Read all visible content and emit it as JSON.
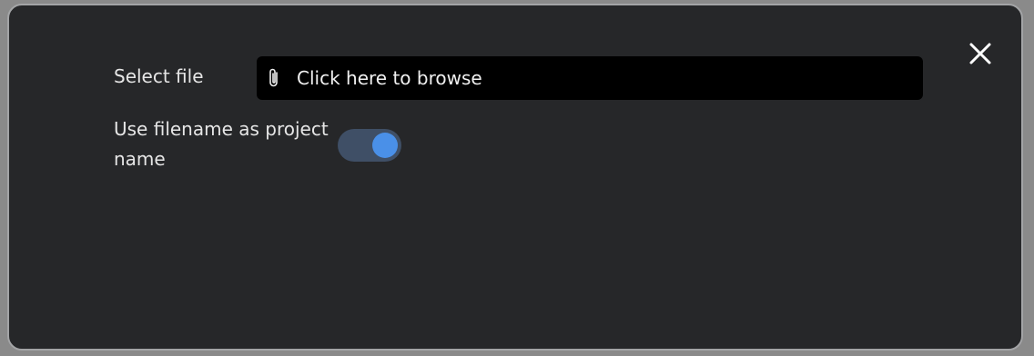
{
  "dialog": {
    "select_file_label": "Select file",
    "file_input_text": "Click here to browse",
    "toggle_label": "Use filename as project name",
    "toggle_on": true
  },
  "icons": {
    "close": "close-icon",
    "attach": "paperclip-icon"
  },
  "colors": {
    "background": "#262729",
    "toggle_track": "#3f4f66",
    "toggle_knob": "#4a90e8"
  }
}
